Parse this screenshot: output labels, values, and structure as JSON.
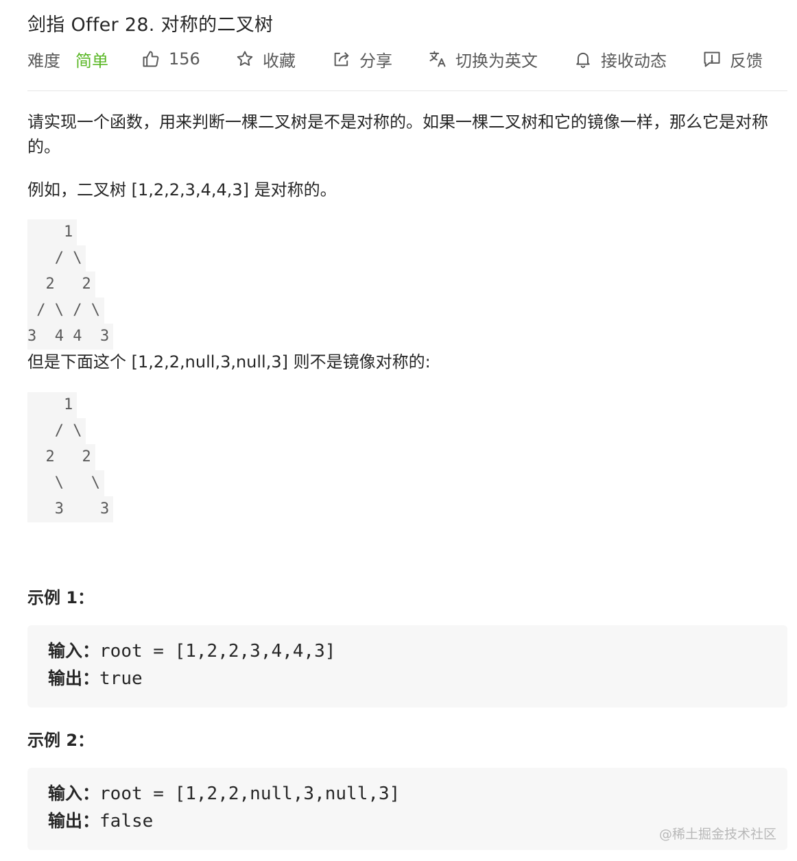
{
  "title": "剑指 Offer 28. 对称的二叉树",
  "toolbar": {
    "difficulty_label": "难度",
    "difficulty_value": "简单",
    "difficulty_color": "#5ab726",
    "likes": "156",
    "favorite": "收藏",
    "share": "分享",
    "translate": "切换为英文",
    "notify": "接收动态",
    "feedback": "反馈"
  },
  "content": {
    "description": "请实现一个函数，用来判断一棵二叉树是不是对称的。如果一棵二叉树和它的镜像一样，那么它是对称的。",
    "example_symmetric": "例如，二叉树 [1,2,2,3,4,4,3] 是对称的。",
    "tree1": [
      "    1",
      "   / \\",
      "  2   2",
      " / \\ / \\",
      "3  4 4  3"
    ],
    "example_asymmetric": "但是下面这个 [1,2,2,null,3,null,3] 则不是镜像对称的:",
    "tree2": [
      "    1",
      "   / \\",
      "  2   2",
      "   \\   \\",
      "   3    3"
    ]
  },
  "examples": [
    {
      "heading": "示例 1：",
      "input_label": "输入：",
      "input_value": "root = [1,2,2,3,4,4,3]",
      "output_label": "输出：",
      "output_value": "true"
    },
    {
      "heading": "示例 2：",
      "input_label": "输入：",
      "input_value": "root = [1,2,2,null,3,null,3]",
      "output_label": "输出：",
      "output_value": "false"
    }
  ],
  "watermark": "@稀土掘金技术社区",
  "icons": [
    "thumbs-up-icon",
    "star-icon",
    "share-icon",
    "translate-icon",
    "bell-icon",
    "feedback-icon"
  ]
}
